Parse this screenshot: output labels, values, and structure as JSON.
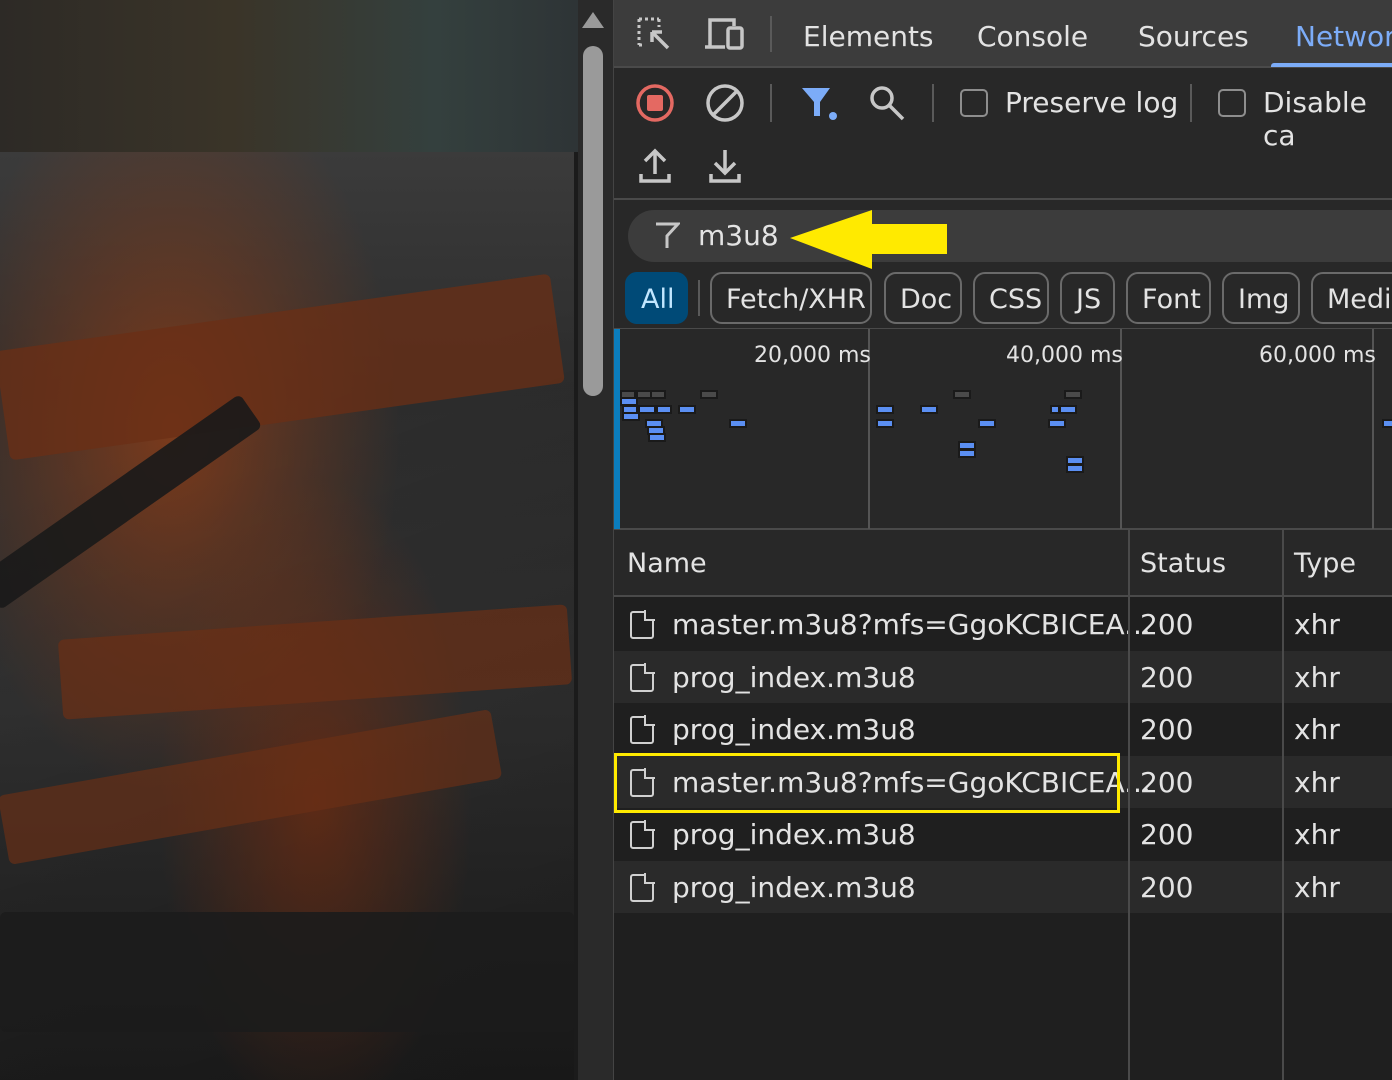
{
  "devtools": {
    "tabs": [
      {
        "label": "Elements",
        "active": false
      },
      {
        "label": "Console",
        "active": false
      },
      {
        "label": "Sources",
        "active": false
      },
      {
        "label": "Networ",
        "active": true
      }
    ],
    "toolbar": {
      "preserve_log_label": "Preserve log",
      "preserve_log_checked": false,
      "disable_cache_label": "Disable ca",
      "disable_cache_checked": false
    },
    "filter": {
      "value": "m3u8"
    },
    "type_chips": [
      {
        "label": "All",
        "active": true
      },
      {
        "label": "Fetch/XHR",
        "active": false
      },
      {
        "label": "Doc",
        "active": false
      },
      {
        "label": "CSS",
        "active": false
      },
      {
        "label": "JS",
        "active": false
      },
      {
        "label": "Font",
        "active": false
      },
      {
        "label": "Img",
        "active": false
      },
      {
        "label": "Medi",
        "active": false
      }
    ],
    "overview_ticks": [
      "20,000 ms",
      "40,000 ms",
      "60,000 ms"
    ],
    "table": {
      "columns": [
        "Name",
        "Status",
        "Type"
      ],
      "rows": [
        {
          "name": "master.m3u8?mfs=GgoKCBICEA...",
          "status": "200",
          "type": "xhr"
        },
        {
          "name": "prog_index.m3u8",
          "status": "200",
          "type": "xhr"
        },
        {
          "name": "prog_index.m3u8",
          "status": "200",
          "type": "xhr"
        },
        {
          "name": "master.m3u8?mfs=GgoKCBICEA...",
          "status": "200",
          "type": "xhr",
          "highlighted": true
        },
        {
          "name": "prog_index.m3u8",
          "status": "200",
          "type": "xhr"
        },
        {
          "name": "prog_index.m3u8",
          "status": "200",
          "type": "xhr"
        }
      ]
    }
  },
  "colors": {
    "accent": "#7cacf8",
    "annotation": "#ffea00",
    "record": "#e46962"
  }
}
